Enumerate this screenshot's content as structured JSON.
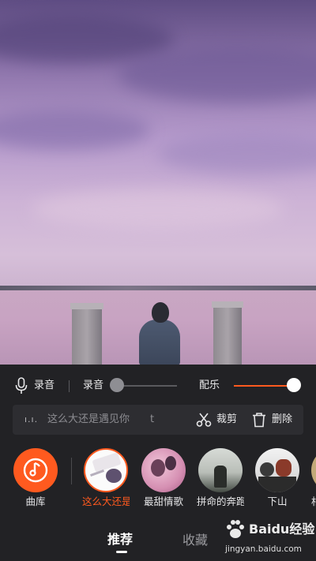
{
  "audio_controls": {
    "record_button_label": "录音",
    "record_volume_label": "录音",
    "record_volume_level": 0.0,
    "music_volume_label": "配乐",
    "music_volume_level": 1.0,
    "accent_color": "#ff5a1f"
  },
  "lyric_bar": {
    "indicator": "ı.ı.",
    "lyric_text": "这么大还是遇见你",
    "trailing_char": "t",
    "cut_label": "裁剪",
    "delete_label": "删除"
  },
  "music_list": {
    "library_label": "曲库",
    "items": [
      {
        "title": "这么大还是遇见你",
        "selected": true
      },
      {
        "title": "最甜情歌",
        "selected": false
      },
      {
        "title": "拼命的奔跑",
        "selected": false
      },
      {
        "title": "下山",
        "selected": false
      },
      {
        "title": "相",
        "selected": false
      }
    ]
  },
  "tabs": {
    "recommend": "推荐",
    "favorites": "收藏",
    "active": "推荐"
  },
  "watermark": {
    "brand": "Baidu经验",
    "url": "jingyan.baidu.com"
  }
}
